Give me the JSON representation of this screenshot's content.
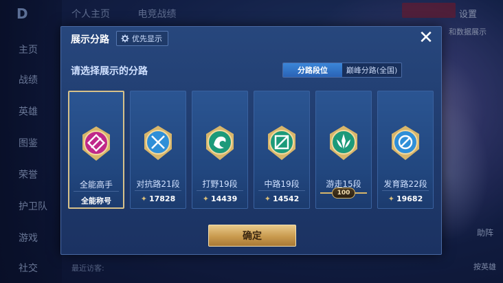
{
  "background": {
    "logo": "D",
    "top_tabs": [
      "个人主页",
      "电竞战绩"
    ],
    "settings_label": "设置",
    "side_hint": "和数据展示",
    "nav_items": [
      "主页",
      "战绩",
      "英雄",
      "图鉴",
      "荣誉",
      "护卫队",
      "游戏",
      "社交"
    ],
    "visitor_label": "最近访客:",
    "right_bottom_label": "助阵",
    "right_bottom_label2": "按英雄"
  },
  "modal": {
    "title": "展示分路",
    "priority_button": "优先显示",
    "close_icon": "close-icon",
    "subtitle": "请选择展示的分路",
    "toggle": {
      "options": [
        "分路段位",
        "巅峰分路(全国)"
      ],
      "selected": "分路段位"
    },
    "cards": [
      {
        "lane": "全能高手",
        "score": "全能称号",
        "icon": "all-round-emblem-icon",
        "selected": true,
        "color": "#c0288a"
      },
      {
        "lane": "对抗路21段",
        "score": "17828",
        "icon": "clash-lane-emblem-icon",
        "selected": false,
        "color": "#2f8fd8"
      },
      {
        "lane": "打野19段",
        "score": "14439",
        "icon": "jungle-emblem-icon",
        "selected": false,
        "color": "#1c9a7a"
      },
      {
        "lane": "中路19段",
        "score": "14542",
        "icon": "mid-lane-emblem-icon",
        "selected": false,
        "color": "#1c9a7a"
      },
      {
        "lane": "游走15段",
        "score": "100",
        "icon": "roam-emblem-icon",
        "selected": false,
        "color": "#1c9a7a",
        "badge": true
      },
      {
        "lane": "发育路22段",
        "score": "19682",
        "icon": "farm-lane-emblem-icon",
        "selected": false,
        "color": "#2f8fd8"
      }
    ],
    "confirm_label": "确定"
  }
}
